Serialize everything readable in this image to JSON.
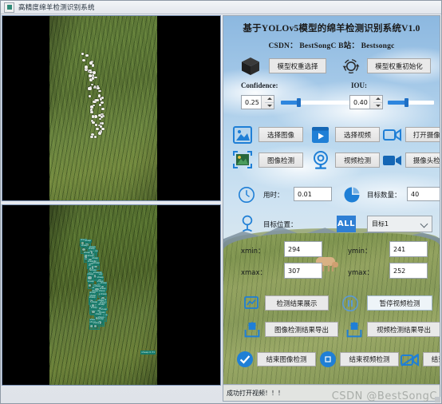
{
  "window": {
    "title": "高精度绵羊检测识别系统",
    "icon": "app-icon"
  },
  "video_panels": {
    "original_label": "original-video-frame",
    "detected_label": "detected-video-frame",
    "detection_tag": "sheep 0.31"
  },
  "panel": {
    "header_title": "基于YOLOv5模型的绵羊检测识别系统V1.0",
    "header_credits": "CSDN： BestSongC    B站： Bestsongc",
    "model": {
      "select_weight_label": "模型权重选择",
      "init_weight_label": "模型权重初始化",
      "cube_icon": "cube-icon",
      "refresh_icon": "refresh-icon"
    },
    "thresholds": {
      "confidence_label": "Confidence:",
      "confidence_value": "0.25",
      "confidence_percent": 25,
      "iou_label": "IOU:",
      "iou_value": "0.40",
      "iou_percent": 40
    },
    "source_buttons": {
      "select_image": "选择图像",
      "select_video": "选择视频",
      "open_camera": "打开摄像头",
      "detect_image": "图像检测",
      "detect_video": "视频检测",
      "detect_camera": "摄像头检测",
      "image_icon": "image-icon",
      "video_icon": "video-icon",
      "camera_icon": "camera-icon",
      "image_detect_icon": "image-scan-icon",
      "video_detect_icon": "webcam-icon",
      "camera_detect_icon": "camcorder-icon"
    },
    "stats": {
      "time_label": "用时：",
      "time_value": "0.01",
      "count_label": "目标数量：",
      "count_value": "40",
      "clock_icon": "clock-icon",
      "pie_icon": "pie-chart-icon"
    },
    "target": {
      "position_label": "目标位置：",
      "all_badge": "ALL",
      "selected_target": "目标1",
      "pin_icon": "location-pin-icon",
      "xmin_label": "xmin：",
      "xmin_value": "294",
      "ymin_label": "ymin：",
      "ymin_value": "241",
      "xmax_label": "xmax：",
      "xmax_value": "307",
      "ymax_label": "ymax：",
      "ymax_value": "252"
    },
    "actions": {
      "show_results": "检测结果展示",
      "pause_video": "暂停视频检测",
      "export_image_results": "图像检测结果导出",
      "export_video_results": "视频检测结果导出",
      "end_image_detect": "结束图像检测",
      "end_video_detect": "结束视频检测",
      "end_camera": "结束摄像头",
      "chart_icon": "chart-line-icon",
      "pause_icon": "pause-icon",
      "export_image_icon": "upload-icon",
      "export_video_icon": "upload-icon",
      "check_icon": "check-circle-icon",
      "stop_icon": "stop-circle-icon",
      "camera_off_icon": "camera-off-icon"
    }
  },
  "status": {
    "message": "成功打开视频！！！",
    "watermark": "CSDN @BestSongC"
  },
  "colors": {
    "accent": "#2f7fd4",
    "slider": "#2e86de",
    "detection": "#17796a"
  }
}
